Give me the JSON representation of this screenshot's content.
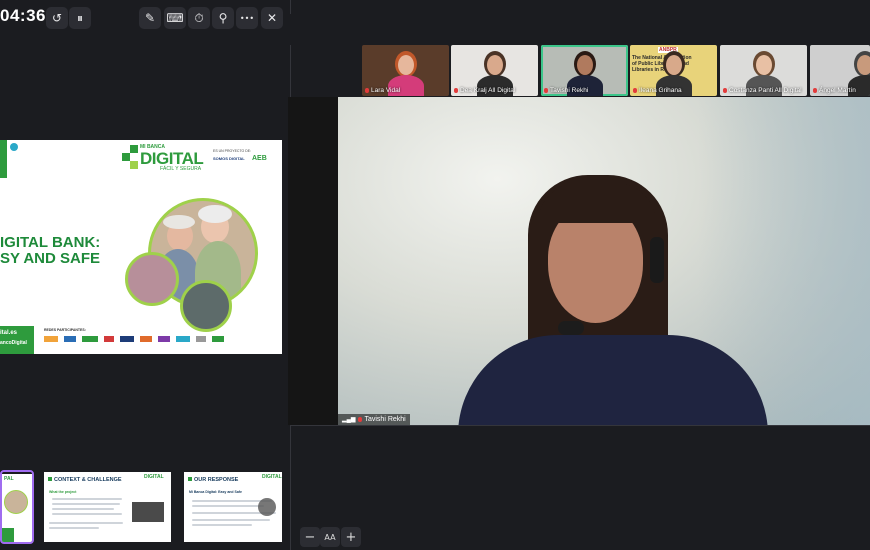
{
  "toolbar": {
    "timer": "04:36",
    "icons": [
      "history-icon",
      "pause-icon",
      "brush-icon",
      "keyboard-icon",
      "stopwatch-icon",
      "usb-icon",
      "more-icon",
      "close-icon"
    ],
    "glyphs": {
      "history": "↺",
      "pause": "⏸",
      "brush": "✎",
      "keyboard": "⌨",
      "stopwatch": "⏱",
      "usb": "⚲",
      "more": "•••",
      "close": "✕"
    }
  },
  "slide": {
    "brand_top": "MI BANCA",
    "brand_main": "DIGITAL",
    "brand_sub": "FÁCIL Y SEGURA",
    "project_label": "ES UN PROYECTO DE:",
    "partner1": "SOMOS DIGITAL",
    "partner2": "AEB",
    "title_line1": "IGITAL BANK:",
    "title_line2": "SY AND SAFE",
    "participants_label": "REDES PARTICIPANTES:",
    "footer_line1": "ital.es",
    "footer_line2": "ancoDigital"
  },
  "thumbnails": [
    {
      "title": "",
      "brand": "PAL"
    },
    {
      "title": "CONTEXT & CHALLENGE",
      "brand": "DIGITAL",
      "subtitle": "What the project"
    },
    {
      "title": "OUR RESPONSE",
      "brand": "DIGITAL",
      "subtitle": "Mi Banca Digital: Easy and Safe"
    }
  ],
  "zoom": {
    "minus": "−",
    "text_size": "AA",
    "plus": "+"
  },
  "participants": [
    {
      "name": "Lara Vidal",
      "bg": "#5a3c2a",
      "skin": "#e6b79c",
      "hair": "#c1582a",
      "shirt": "#d43c7a"
    },
    {
      "name": "Dea Kralj All Digital",
      "bg": "#e7e5e2",
      "skin": "#d9a98c",
      "hair": "#4a3326",
      "shirt": "#2b2b2b"
    },
    {
      "name": "Tavishi Rekhi",
      "bg": "#b7bcb6",
      "skin": "#b07a5e",
      "hair": "#2a1a14",
      "shirt": "#1e2338"
    },
    {
      "name": "Ileana Grihana",
      "bg": "#e8d37a",
      "skin": "#d8a98a",
      "hair": "#3a2a20",
      "shirt": "#333"
    },
    {
      "name": "Costanza Panti All Digital",
      "bg": "#dcdcda",
      "skin": "#e8c0a4",
      "hair": "#6a4a32",
      "shirt": "#555"
    },
    {
      "name": "Ángel Martín",
      "bg": "#cfcfcf",
      "skin": "#c89a7c",
      "hair": "#444",
      "shirt": "#2a2a2a"
    }
  ],
  "banner_text": "The National Association of Public Librarians and Libraries in Romania",
  "banner_logo": "ANBPR",
  "main_speaker": {
    "name": "Tavishi Rekhi"
  },
  "colors": {
    "brand_green": "#2e9b3d",
    "active_border": "#3cc58a",
    "thumb_selected": "#a06cf0",
    "mic_red": "#e23b3b"
  }
}
